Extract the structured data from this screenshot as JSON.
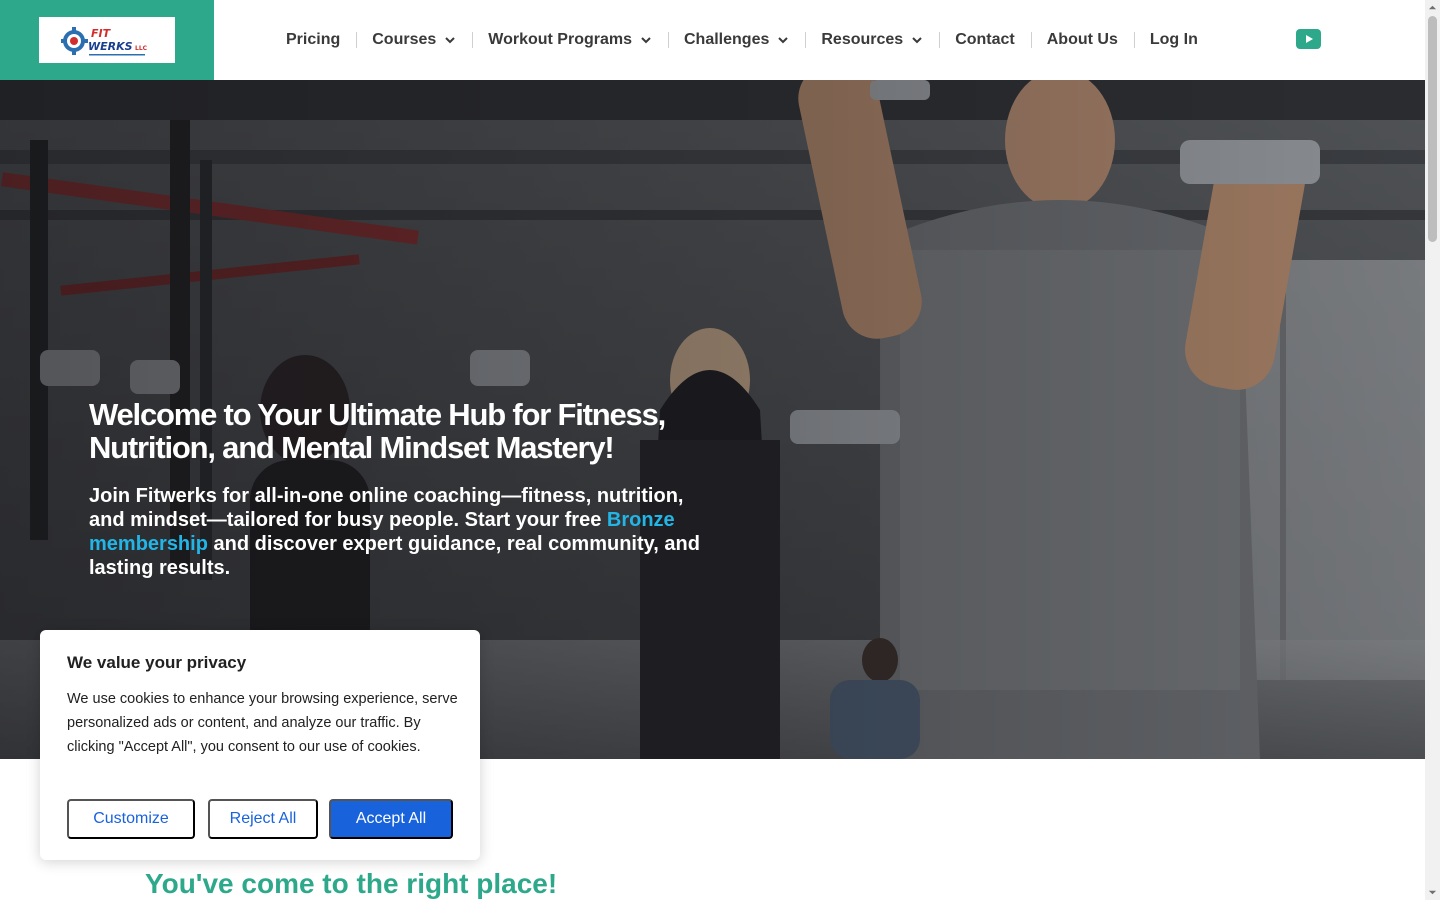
{
  "header": {
    "logo_alt": "Fit Werks LLC",
    "nav": [
      {
        "label": "Pricing",
        "has_dropdown": false
      },
      {
        "label": "Courses",
        "has_dropdown": true
      },
      {
        "label": "Workout Programs",
        "has_dropdown": true
      },
      {
        "label": "Challenges",
        "has_dropdown": true
      },
      {
        "label": "Resources",
        "has_dropdown": true
      },
      {
        "label": "Contact",
        "has_dropdown": false
      },
      {
        "label": "About Us",
        "has_dropdown": false
      },
      {
        "label": "Log In",
        "has_dropdown": false
      }
    ],
    "social_icon": "youtube-icon"
  },
  "hero": {
    "title": "Welcome to Your Ultimate Hub for Fitness, Nutrition, and Mental Mindset Mastery!",
    "subtitle_before": "Join Fitwerks for all-in-one online coaching—fitness, nutrition, and mindset—tailored for busy people. Start your free ",
    "subtitle_link": "Bronze membership",
    "subtitle_after": " and discover expert guidance, real community, and lasting results."
  },
  "section": {
    "heading": "You've come to the right place!"
  },
  "cookie_banner": {
    "title": "We value your privacy",
    "text": "We use cookies to enhance your browsing experience, serve personalized ads or content, and analyze our traffic. By clicking \"Accept All\", you consent to our use of cookies.",
    "customize_label": "Customize",
    "reject_label": "Reject All",
    "accept_label": "Accept All"
  },
  "colors": {
    "brand_teal": "#2ea88b",
    "link_blue": "#22b5e6",
    "button_blue": "#1863dc",
    "nav_text": "#3a3a3a"
  }
}
